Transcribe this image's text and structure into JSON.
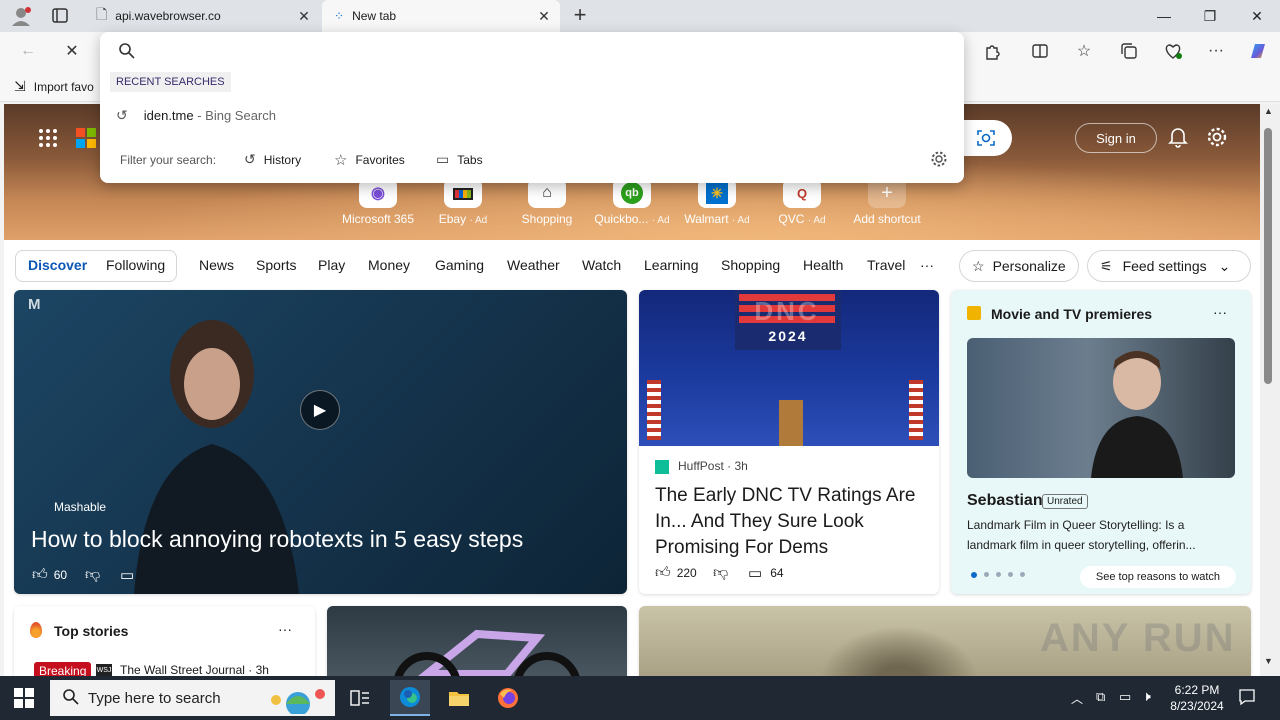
{
  "browser": {
    "tabs": [
      {
        "title": "api.wavebrowser.co",
        "active": false
      },
      {
        "title": "New tab",
        "active": true
      }
    ],
    "new_tab_symbol": "+",
    "window_controls": {
      "minimize": "—",
      "maximize": "❐",
      "close": "✕"
    },
    "favorites_bar": {
      "import": "Import favo"
    }
  },
  "omnibox": {
    "query": "",
    "recent_header": "RECENT SEARCHES",
    "recent_items": [
      {
        "text": "iden.tme",
        "suffix": " - Bing Search"
      }
    ],
    "filter_label": "Filter your search:",
    "filters": [
      "History",
      "Favorites",
      "Tabs"
    ]
  },
  "newtab": {
    "signin": "Sign in",
    "shortcuts": [
      {
        "label": "Microsoft 365",
        "ad": ""
      },
      {
        "label": "Ebay",
        "ad": "· Ad"
      },
      {
        "label": "Shopping",
        "ad": ""
      },
      {
        "label": "Quickbo...",
        "ad": "· Ad"
      },
      {
        "label": "Walmart",
        "ad": "· Ad"
      },
      {
        "label": "QVC",
        "ad": "· Ad"
      },
      {
        "label": "Add shortcut",
        "ad": ""
      }
    ],
    "tabs": [
      "Discover",
      "Following"
    ],
    "nav": [
      "News",
      "Sports",
      "Play",
      "Money",
      "Gaming",
      "Weather",
      "Watch",
      "Learning",
      "Shopping",
      "Health",
      "Travel"
    ],
    "more": "···",
    "personalize": "Personalize",
    "feed_settings": "Feed settings"
  },
  "cards": {
    "main": {
      "source": "Mashable",
      "title": "How to block annoying robotexts in 5 easy steps",
      "likes": "60"
    },
    "huffpost": {
      "source": "HuffPost",
      "age": "· 3h",
      "title": "The Early DNC TV Ratings Are In... And They Sure Look Promising For Dems",
      "likes": "220",
      "comments": "64",
      "banner": "DNC",
      "year": "2024"
    },
    "movie": {
      "header": "Movie and TV premieres",
      "title": "Sebastian",
      "badge": "Unrated",
      "desc": "Landmark Film in Queer Storytelling: Is a landmark film in queer storytelling, offerin...",
      "cta": "See top reasons to watch"
    },
    "topstories": {
      "header": "Top stories",
      "breaking": "Breaking",
      "source": "The Wall Street Journal · 3h"
    }
  },
  "taskbar": {
    "search_placeholder": "Type here to search",
    "time": "6:22 PM",
    "date": "8/23/2024"
  },
  "watermark": "ANY RUN"
}
